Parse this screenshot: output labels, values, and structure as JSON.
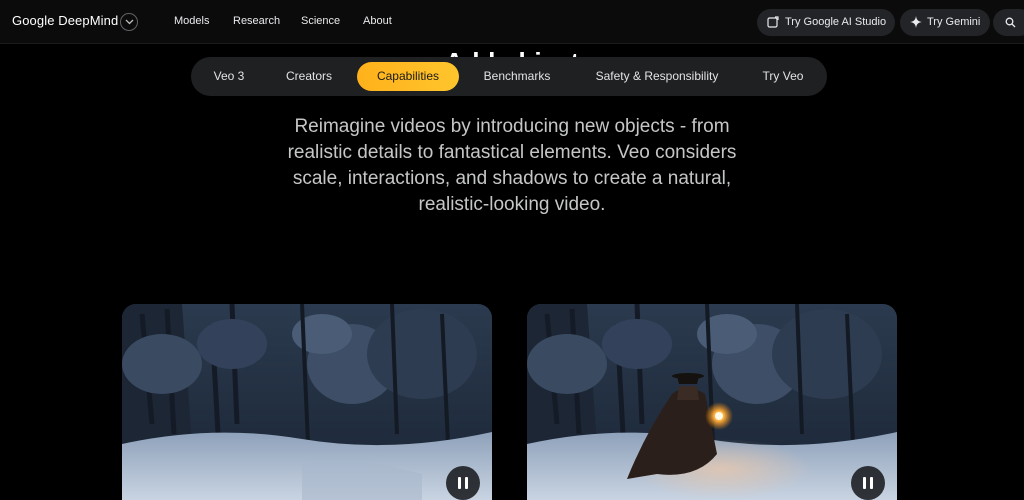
{
  "brand": {
    "name": "Google DeepMind",
    "menu_icon": "chevron-down-icon"
  },
  "nav": {
    "links": [
      "Models",
      "Research",
      "Science",
      "About"
    ],
    "try_ai_studio": "Try Google AI Studio",
    "try_gemini": "Try Gemini",
    "search_icon": "search-icon"
  },
  "section": {
    "heading": "Add object"
  },
  "tabs": [
    {
      "label": "Veo 3",
      "active": false
    },
    {
      "label": "Creators",
      "active": false
    },
    {
      "label": "Capabilities",
      "active": true
    },
    {
      "label": "Benchmarks",
      "active": false
    },
    {
      "label": "Safety & Responsibility",
      "active": false
    },
    {
      "label": "Try Veo",
      "active": false
    }
  ],
  "intro": {
    "text": "Reimagine videos by introducing new objects - from realistic details to fantastical elements. Veo considers scale, interactions, and shadows to create a natural, realistic-looking video."
  },
  "videos": [
    {
      "name": "original-video",
      "control_icon": "pause-icon"
    },
    {
      "name": "edited-video",
      "control_icon": "pause-icon"
    }
  ],
  "colors": {
    "accent": "#ffb11b",
    "background": "#000000",
    "surface": "#1f2022"
  }
}
